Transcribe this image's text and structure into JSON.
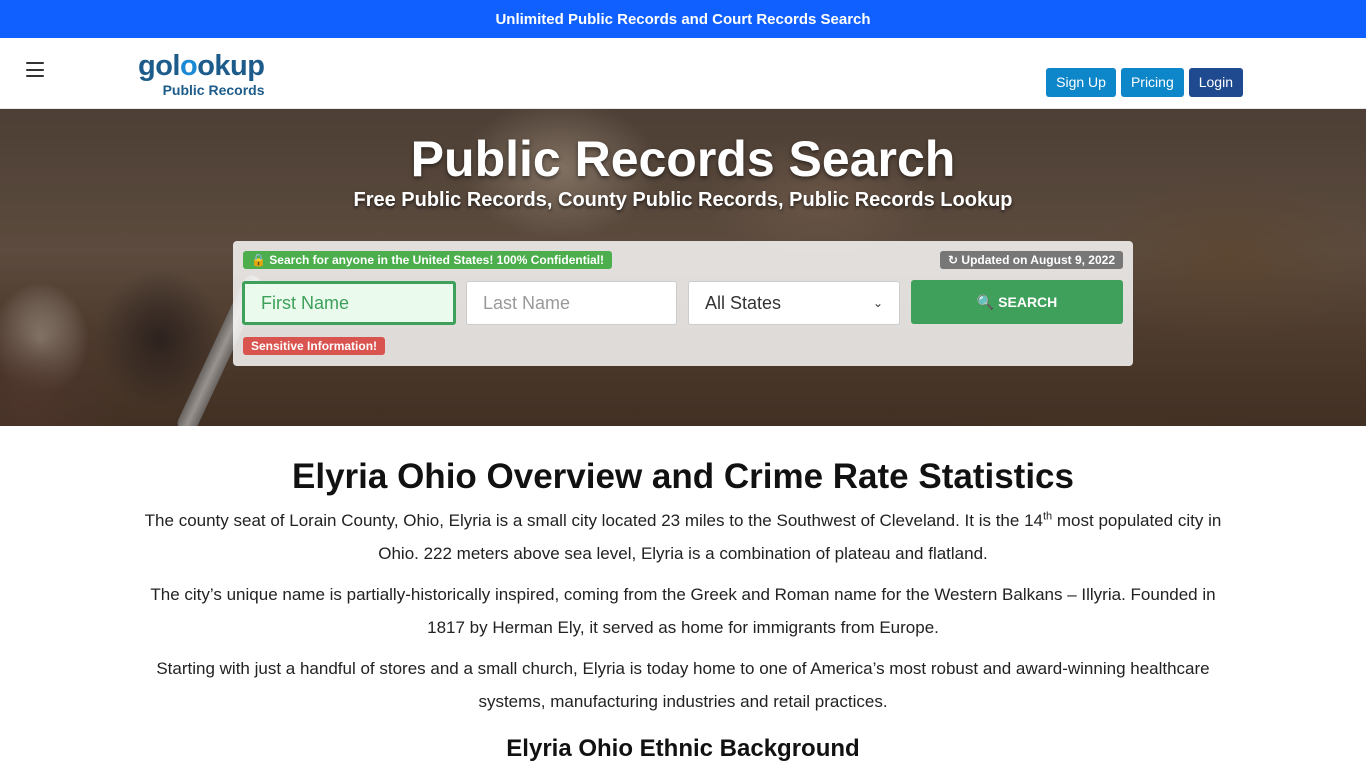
{
  "topbar": {
    "text": "Unlimited Public Records and Court Records Search"
  },
  "header": {
    "logo_main_a": "gol",
    "logo_main_o": "o",
    "logo_main_b": "okup",
    "logo_sub": "Public Records",
    "signup_label": "Sign Up",
    "pricing_label": "Pricing",
    "login_label": "Login"
  },
  "hero": {
    "title": "Public Records Search",
    "subtitle": "Free Public Records, County Public Records, Public Records Lookup"
  },
  "search": {
    "confidential_badge": "Search for anyone in the United States! 100% Confidential!",
    "updated_badge": "Updated on August 9, 2022",
    "sensitive_badge": "Sensitive Information!",
    "first_name_placeholder": "First Name",
    "last_name_placeholder": "Last Name",
    "state_selected": "All States",
    "search_label": "SEARCH"
  },
  "article": {
    "title": "Elyria Ohio Overview and Crime Rate Statistics",
    "p1_a": "The county seat of Lorain County, Ohio, Elyria is a small city located 23 miles to the Southwest of Cleveland. It is the 14",
    "p1_sup": "th",
    "p1_b": " most populated city in Ohio. 222 meters above sea level, Elyria is a  combination of plateau and flatland.",
    "p2": "The city’s unique name is partially-historically inspired, coming from the Greek and Roman name for the Western Balkans – Illyria. Founded in 1817 by Herman Ely, it served as home for immigrants from Europe.",
    "p3": "Starting with just a handful of stores and a small church, Elyria is today home to one of America’s most robust and award-winning healthcare systems, manufacturing industries and retail practices.",
    "subheading": "Elyria Ohio Ethnic Background"
  },
  "colors": {
    "topbar": "#1060ff",
    "brand": "#1d5c8a",
    "signup": "#0d87c9",
    "login": "#1f4a8f",
    "search_green": "#3ea05a",
    "sensitive_red": "#d9534f"
  },
  "icons": [
    "menu-icon",
    "lock-icon",
    "refresh-icon",
    "search-icon",
    "chevron-down-icon"
  ]
}
